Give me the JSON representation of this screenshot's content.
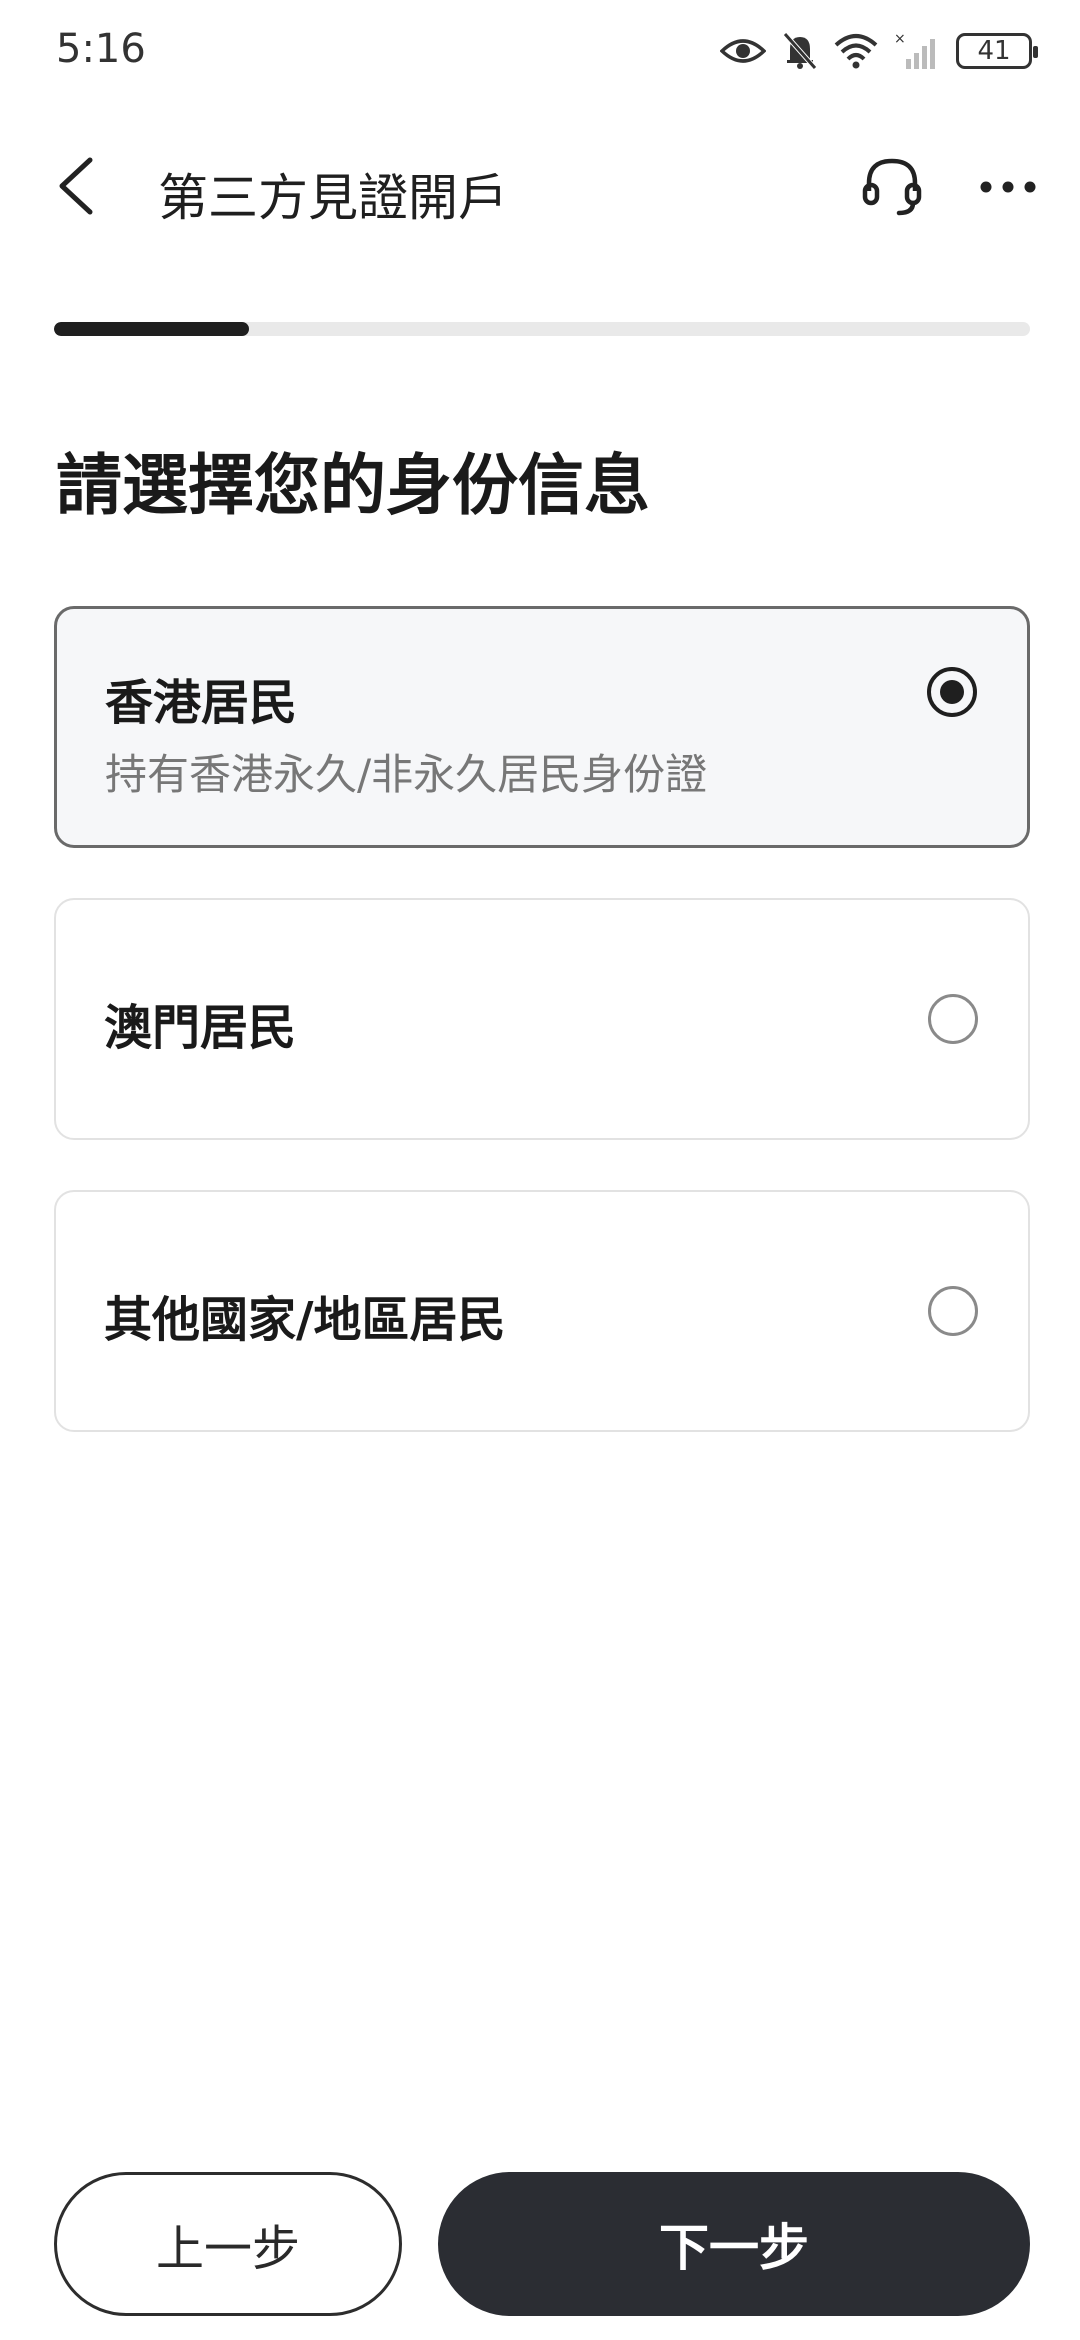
{
  "status_bar": {
    "time": "5:16",
    "battery_level": "41",
    "icons": [
      "eye-icon",
      "bell-muted-icon",
      "wifi-icon",
      "signal-icon",
      "battery-icon"
    ]
  },
  "nav": {
    "title": "第三方見證開戶",
    "icons": [
      "back-arrow-icon",
      "headset-icon",
      "more-icon"
    ]
  },
  "progress": {
    "fraction": 0.2
  },
  "heading": "請選擇您的身份信息",
  "options": [
    {
      "title": "香港居民",
      "subtitle": "持有香港永久/非永久居民身份證",
      "selected": true
    },
    {
      "title": "澳門居民",
      "subtitle": "",
      "selected": false
    },
    {
      "title": "其他國家/地區居民",
      "subtitle": "",
      "selected": false
    }
  ],
  "buttons": {
    "prev_label": "上一步",
    "next_label": "下一步"
  },
  "colors": {
    "primary": "#2b2d33",
    "selected_card_bg": "#f6f7f9",
    "progress_track": "#e9e9e9"
  }
}
